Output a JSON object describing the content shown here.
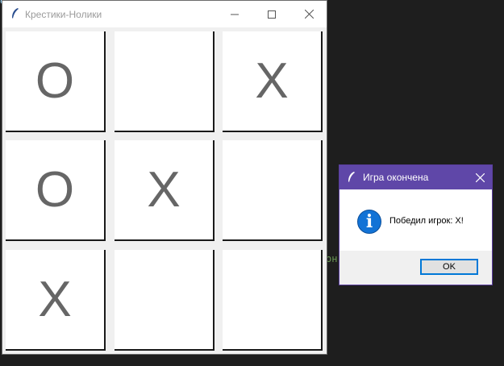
{
  "main_window": {
    "title": "Крестики-Нолики",
    "board": [
      [
        "O",
        "",
        "X"
      ],
      [
        "O",
        "X",
        ""
      ],
      [
        "X",
        "",
        ""
      ]
    ]
  },
  "dialog": {
    "title": "Игра окончена",
    "message": "Победил игрок: X!",
    "ok_label": "OK",
    "icon": "info-icon"
  },
  "colors": {
    "dialog_titlebar": "#5f47a8",
    "info_icon": "#1273d6",
    "mark": "#666666"
  }
}
